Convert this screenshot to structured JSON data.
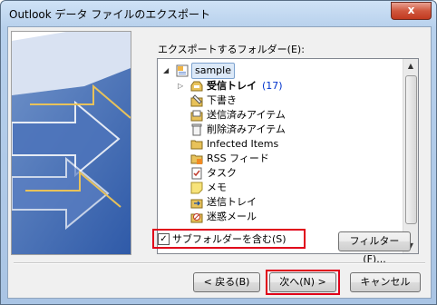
{
  "window": {
    "title": "Outlook データ ファイルのエクスポート",
    "close_glyph": "x"
  },
  "export": {
    "prompt_label": "エクスポートするフォルダー(E):",
    "tree": {
      "root": "sample",
      "items": [
        {
          "label": "受信トレイ",
          "count": "(17)",
          "icon": "inbox-icon"
        },
        {
          "label": "下書き",
          "icon": "drafts-icon"
        },
        {
          "label": "送信済みアイテム",
          "icon": "sent-items-icon"
        },
        {
          "label": "削除済みアイテム",
          "icon": "trash-icon"
        },
        {
          "label": "Infected Items",
          "icon": "folder-icon"
        },
        {
          "label": "RSS フィード",
          "icon": "rss-feed-icon"
        },
        {
          "label": "タスク",
          "icon": "tasks-icon"
        },
        {
          "label": "メモ",
          "icon": "notes-icon"
        },
        {
          "label": "送信トレイ",
          "icon": "outbox-icon"
        },
        {
          "label": "迷惑メール",
          "icon": "junk-mail-icon"
        }
      ]
    },
    "include_subfolders_label": "サブフォルダーを含む(S)",
    "include_subfolders_checked": true,
    "filter_button": "フィルター(F)..."
  },
  "footer": {
    "back_button": "< 戻る(B)",
    "next_button": "次へ(N) >",
    "cancel_button": "キャンセル"
  },
  "colors": {
    "highlight_frame": "#e0001a",
    "count_text": "#0033cc",
    "folder_yellow": "#e8c25a"
  }
}
